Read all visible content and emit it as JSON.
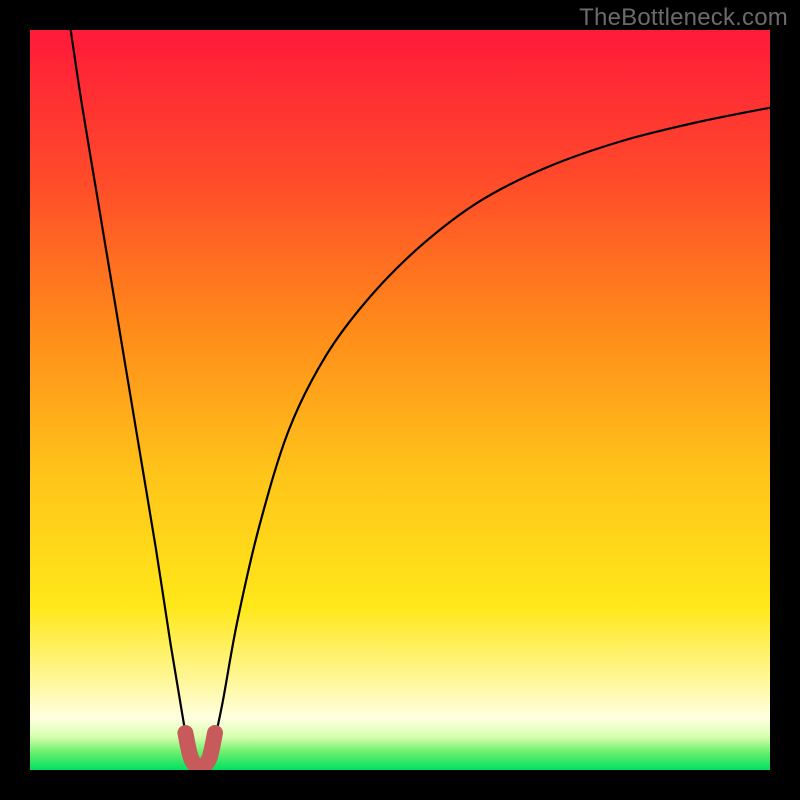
{
  "watermark": "TheBottleneck.com",
  "chart_data": {
    "type": "line",
    "title": "",
    "xlabel": "",
    "ylabel": "",
    "xlim": [
      0,
      100
    ],
    "ylim": [
      0,
      100
    ],
    "gradient_stops": [
      {
        "offset": 0.0,
        "color": "#ff1a3a"
      },
      {
        "offset": 0.2,
        "color": "#ff4a2a"
      },
      {
        "offset": 0.4,
        "color": "#ff8a1a"
      },
      {
        "offset": 0.6,
        "color": "#ffc41a"
      },
      {
        "offset": 0.78,
        "color": "#ffe81a"
      },
      {
        "offset": 0.88,
        "color": "#fff79a"
      },
      {
        "offset": 0.93,
        "color": "#ffffe0"
      },
      {
        "offset": 0.955,
        "color": "#d8ffb0"
      },
      {
        "offset": 0.975,
        "color": "#70f070"
      },
      {
        "offset": 1.0,
        "color": "#00e060"
      }
    ],
    "series": [
      {
        "name": "left-branch",
        "x": [
          5.5,
          7.0,
          9.0,
          11.0,
          13.0,
          15.0,
          17.0,
          19.0,
          20.5,
          21.5
        ],
        "y": [
          100,
          90,
          78,
          66,
          54,
          42,
          30,
          17,
          8,
          2
        ]
      },
      {
        "name": "right-branch",
        "x": [
          24.5,
          26.0,
          28.0,
          31.0,
          35.0,
          40.0,
          46.0,
          53.0,
          61.0,
          70.0,
          80.0,
          90.0,
          100.0
        ],
        "y": [
          2,
          9,
          20,
          33,
          46,
          56,
          64,
          71,
          77,
          81.5,
          85,
          87.5,
          89.5
        ]
      }
    ],
    "marker": {
      "name": "u-marker",
      "color": "#c75a5a",
      "stroke_width": 16,
      "points_x": [
        21.0,
        21.8,
        23.0,
        24.2,
        25.0
      ],
      "points_y": [
        5.0,
        1.5,
        0.5,
        1.5,
        5.0
      ]
    }
  }
}
